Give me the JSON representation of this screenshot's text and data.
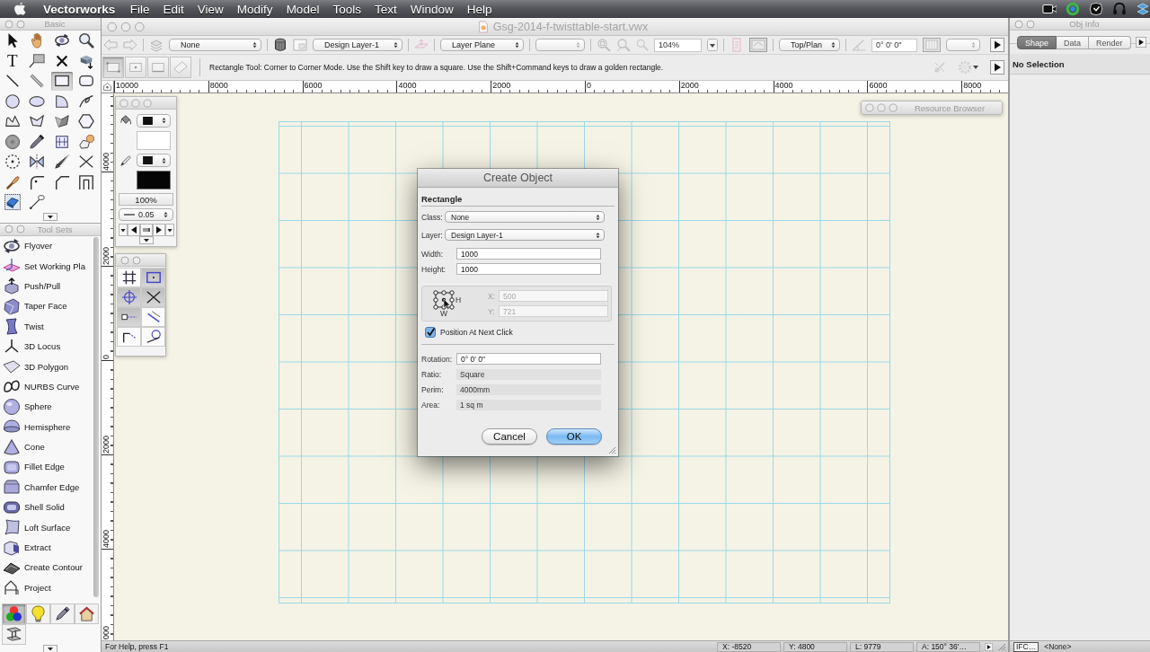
{
  "menu_bar": {
    "app_name": "Vectorworks",
    "menus": [
      "File",
      "Edit",
      "View",
      "Modify",
      "Model",
      "Tools",
      "Text",
      "Window",
      "Help"
    ]
  },
  "basic_palette": {
    "title": "Basic",
    "tools": [
      {
        "selected": false
      },
      {
        "selected": false
      },
      {
        "selected": false
      },
      {
        "selected": false
      },
      {
        "glyph": "T",
        "selected": false
      },
      {
        "selected": false
      },
      {
        "selected": false
      },
      {
        "selected": false
      },
      {
        "selected": false
      },
      {
        "selected": false
      },
      {
        "selected": true
      },
      {
        "selected": false
      },
      {
        "selected": false
      },
      {
        "selected": false
      },
      {
        "selected": false
      },
      {
        "selected": false
      },
      {
        "selected": false
      },
      {
        "selected": false
      },
      {
        "selected": false
      },
      {
        "selected": false
      },
      {
        "selected": false
      },
      {
        "selected": false
      },
      {
        "selected": false
      },
      {
        "selected": false
      },
      {
        "selected": false
      },
      {
        "selected": false
      },
      {
        "selected": false
      },
      {
        "selected": false
      },
      {
        "selected": false
      },
      {
        "selected": false
      },
      {
        "selected": false
      },
      {
        "selected": false
      },
      {
        "selected": false
      },
      {
        "selected": false
      }
    ]
  },
  "tool_sets_palette": {
    "title": "Tool Sets",
    "items": [
      {
        "label": "Flyover"
      },
      {
        "label": "Set Working Pla"
      },
      {
        "label": "Push/Pull"
      },
      {
        "label": "Taper Face"
      },
      {
        "label": "Twist"
      },
      {
        "label": "3D Locus"
      },
      {
        "label": "3D Polygon"
      },
      {
        "label": "NURBS Curve"
      },
      {
        "label": "Sphere"
      },
      {
        "label": "Hemisphere"
      },
      {
        "label": "Cone"
      },
      {
        "label": "Fillet Edge"
      },
      {
        "label": "Chamfer Edge"
      },
      {
        "label": "Shell Solid"
      },
      {
        "label": "Loft Surface"
      },
      {
        "label": "Extract"
      },
      {
        "label": "Create Contour"
      },
      {
        "label": "Project"
      }
    ],
    "tabs": [
      {
        "selected": true
      },
      {
        "selected": false
      },
      {
        "selected": false
      },
      {
        "selected": false
      },
      {
        "selected": false
      }
    ]
  },
  "document_window": {
    "title": "Gsg-2014-f-twisttable-start.vwx",
    "view_bar": {
      "class_menu": "None",
      "layer_menu": "Design Layer-1",
      "plane_menu": "Layer Plane",
      "zoom": "104%",
      "view_menu": "Top/Plan",
      "rotation": "0° 0' 0\""
    },
    "mode_bar": {
      "modes": [
        {
          "selected": true
        },
        {
          "selected": false
        },
        {
          "selected": false
        },
        {
          "selected": false
        }
      ],
      "help_text": "Rectangle Tool: Corner to Corner Mode. Use the Shift key to draw a square. Use the Shift+Command keys to draw a golden rectangle."
    },
    "top_ruler": [
      "10000",
      "8000",
      "6000",
      "4000",
      "2000",
      "0",
      "2000",
      "4000",
      "6000",
      "8000"
    ],
    "left_ruler": [
      "4000",
      "2000",
      "0",
      "2000",
      "4000",
      "000"
    ],
    "status_bar": {
      "help": "For Help, press F1",
      "readouts": [
        "X: -8520",
        "Y: 4800",
        "L: 9779",
        "A: 150° 36'…"
      ]
    }
  },
  "attributes_palette": {
    "opacity": "100%",
    "line_weight": "0.05"
  },
  "snaps_palette": {
    "snaps": [
      {
        "on": false
      },
      {
        "on": true
      },
      {
        "on": true
      },
      {
        "on": true
      },
      {
        "on": true
      },
      {
        "on": false
      },
      {
        "on": false
      },
      {
        "on": false
      }
    ]
  },
  "resource_browser": {
    "title": "Resource Browser"
  },
  "dialog": {
    "title": "Create Object",
    "section": "Rectangle",
    "fields": [
      {
        "kind": "menu",
        "label": "Class:",
        "value": "None"
      },
      {
        "kind": "menu",
        "label": "Layer:",
        "value": "Design Layer-1"
      },
      {
        "kind": "input",
        "label": "Width:",
        "value": "1000"
      },
      {
        "kind": "input",
        "label": "Height:",
        "value": "1000"
      }
    ],
    "position": {
      "h_label": "H",
      "w_label": "W",
      "x": {
        "label": "X:",
        "value": "500",
        "disabled": true
      },
      "y": {
        "label": "Y:",
        "value": "721",
        "disabled": true
      }
    },
    "checkbox": {
      "label": "Position At Next Click",
      "checked": true
    },
    "rotation": {
      "label": "Rotation:",
      "value": "0° 0' 0\""
    },
    "readouts": [
      {
        "label": "Ratio:",
        "value": "Square"
      },
      {
        "label": "Perim:",
        "value": "4000mm"
      },
      {
        "label": "Area:",
        "value": "1 sq m"
      }
    ],
    "buttons": [
      {
        "label": "Cancel",
        "default": false
      },
      {
        "label": "OK",
        "default": true
      }
    ]
  },
  "obj_info": {
    "title": "Obj Info",
    "tabs": [
      {
        "label": "Shape",
        "selected": true
      },
      {
        "label": "Data",
        "selected": false
      },
      {
        "label": "Render",
        "selected": false
      }
    ],
    "message": "No Selection",
    "ifc_button": "IFC…",
    "class_value": "<None>"
  }
}
